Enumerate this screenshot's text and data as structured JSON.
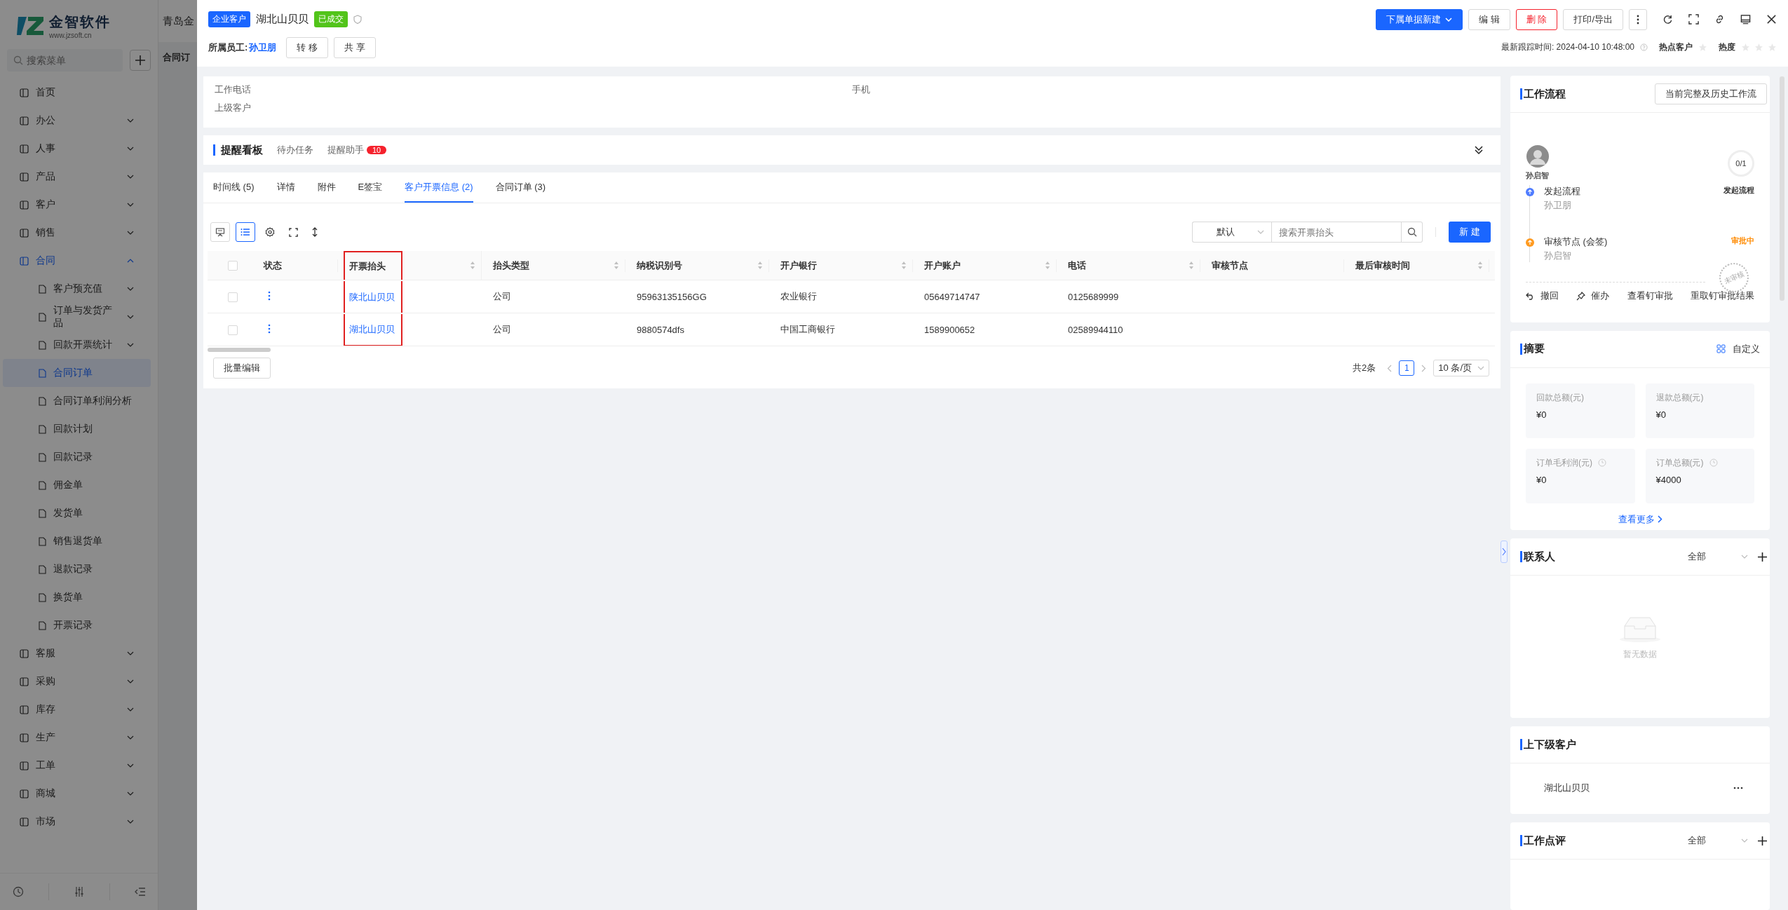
{
  "background_app": {
    "header_title": "青岛金",
    "tab": "合同订"
  },
  "sidebar": {
    "logo": {
      "name": "金智软件",
      "url": "www.jzsoft.cn"
    },
    "search": {
      "placeholder": "搜索菜单"
    },
    "items": [
      {
        "label": "首页",
        "selected": false
      },
      {
        "label": "办公",
        "selected": false,
        "expanded": false
      },
      {
        "label": "人事",
        "selected": false,
        "expanded": false
      },
      {
        "label": "产品",
        "selected": false,
        "expanded": false
      },
      {
        "label": "客户",
        "selected": false,
        "expanded": false
      },
      {
        "label": "销售",
        "selected": false,
        "expanded": false
      },
      {
        "label": "合同",
        "selected": true,
        "expanded": true,
        "children": [
          {
            "label": "客户预充值",
            "selected": false,
            "expanded": false
          },
          {
            "label": "订单与发货产品",
            "selected": false,
            "expanded": false
          },
          {
            "label": "回款开票统计",
            "selected": false,
            "expanded": false
          },
          {
            "label": "合同订单",
            "selected": true
          },
          {
            "label": "合同订单利润分析",
            "selected": false
          },
          {
            "label": "回款计划",
            "selected": false
          },
          {
            "label": "回款记录",
            "selected": false
          },
          {
            "label": "佣金单",
            "selected": false
          },
          {
            "label": "发货单",
            "selected": false
          },
          {
            "label": "销售退货单",
            "selected": false
          },
          {
            "label": "退款记录",
            "selected": false
          },
          {
            "label": "换货单",
            "selected": false
          },
          {
            "label": "开票记录",
            "selected": false
          }
        ]
      },
      {
        "label": "客服",
        "selected": false,
        "expanded": false
      },
      {
        "label": "采购",
        "selected": false,
        "expanded": false
      },
      {
        "label": "库存",
        "selected": false,
        "expanded": false
      },
      {
        "label": "生产",
        "selected": false,
        "expanded": false
      },
      {
        "label": "工单",
        "selected": false,
        "expanded": false
      },
      {
        "label": "商城",
        "selected": false,
        "expanded": false
      },
      {
        "label": "市场",
        "selected": false,
        "expanded": false
      }
    ]
  },
  "header": {
    "type_badge": "企业客户",
    "title": "湖北山贝贝",
    "status_badge": "已成交",
    "owner_label": "所属员工:",
    "owner": "孙卫朋",
    "owner_buttons": [
      "转 移",
      "共 享"
    ],
    "actions": [
      {
        "label": "下属单据新建",
        "kind": "primary"
      },
      {
        "label": "编 辑",
        "kind": "default"
      },
      {
        "label": "删 除",
        "kind": "danger"
      },
      {
        "label": "打印/导出",
        "kind": "default"
      }
    ],
    "last_track": "最新跟踪时间: 2024-04-10 10:48:00",
    "hot_customer": {
      "label": "热点客户",
      "on": false
    },
    "heat": {
      "label": "热度",
      "stars": 0
    }
  },
  "info": {
    "fields": [
      "工作电话",
      "手机",
      "上级客户"
    ]
  },
  "reminder": {
    "title": "提醒看板",
    "tabs": [
      {
        "label": "待办任务",
        "selected": false
      },
      {
        "label": "提醒助手",
        "badge": "10",
        "selected": false
      }
    ]
  },
  "tabs": [
    {
      "label": "时间线 (5)",
      "selected": false
    },
    {
      "label": "详情",
      "selected": false
    },
    {
      "label": "附件",
      "selected": false
    },
    {
      "label": "E签宝",
      "selected": false
    },
    {
      "label": "客户开票信息 (2)",
      "selected": true
    },
    {
      "label": "合同订单 (3)",
      "selected": false
    }
  ],
  "toolbar": {
    "views": [
      {
        "kind": "card",
        "selected": false
      },
      {
        "kind": "list",
        "selected": true
      }
    ],
    "filter": "默认",
    "search": {
      "placeholder": "搜索开票抬头"
    },
    "new_button": "新 建"
  },
  "table": {
    "all_checked": false,
    "columns": [
      {
        "label": "状态",
        "sortable": false,
        "highlighted": false
      },
      {
        "label": "开票抬头",
        "sortable": true,
        "highlighted": true
      },
      {
        "label": "抬头类型",
        "sortable": true,
        "highlighted": false
      },
      {
        "label": "纳税识别号",
        "sortable": true,
        "highlighted": false
      },
      {
        "label": "开户银行",
        "sortable": true,
        "highlighted": false
      },
      {
        "label": "开户账户",
        "sortable": true,
        "highlighted": false
      },
      {
        "label": "电话",
        "sortable": true,
        "highlighted": false
      },
      {
        "label": "审核节点",
        "sortable": false,
        "highlighted": false
      },
      {
        "label": "最后审核时间",
        "sortable": true,
        "highlighted": false
      }
    ],
    "rows": [
      {
        "checked": false,
        "cells": [
          "",
          "陕北山贝贝",
          "公司",
          "95963135156GG",
          "农业银行",
          "05649714747",
          "0125689999"
        ]
      },
      {
        "checked": false,
        "cells": [
          "",
          "湖北山贝贝",
          "公司",
          "9880574dfs",
          "中国工商银行",
          "1589900652",
          "02589944110"
        ]
      }
    ]
  },
  "bulk_edit": "批量编辑",
  "pagination": {
    "total": "共2条",
    "pages": [
      {
        "label": "1",
        "selected": true
      }
    ],
    "page_size": "10 条/页"
  },
  "workflow": {
    "title": "工作流程",
    "history_button": "当前完整及历史工作流",
    "assignee": "孙启智",
    "progress": "0/1",
    "steps": [
      {
        "kind": "start",
        "title": "发起流程",
        "person": "孙卫朋",
        "status": "发起流程"
      },
      {
        "kind": "review",
        "title": "审核节点 (会签)",
        "person": "孙启智",
        "status": "审批中"
      }
    ],
    "stamp": "未审核",
    "actions": [
      {
        "kind": "undo",
        "label": "撤回"
      },
      {
        "kind": "pin",
        "label": "催办"
      },
      {
        "kind": "text",
        "label": "查看钉审批"
      },
      {
        "kind": "text",
        "label": "重取钉审批结果"
      }
    ]
  },
  "summary": {
    "title": "摘要",
    "customize": "自定义",
    "stats": [
      {
        "label": "回款总额(元)",
        "value": "¥0",
        "info": false
      },
      {
        "label": "退款总额(元)",
        "value": "¥0",
        "info": false
      },
      {
        "label": "订单毛利润(元)",
        "value": "¥0",
        "info": true
      },
      {
        "label": "订单总额(元)",
        "value": "¥4000",
        "info": true
      }
    ],
    "more": "查看更多"
  },
  "contacts": {
    "title": "联系人",
    "filter": "全部",
    "empty_text": "暂无数据"
  },
  "relations": {
    "title": "上下级客户",
    "items": [
      "湖北山贝贝"
    ]
  },
  "reviews": {
    "title": "工作点评",
    "filter": "全部"
  }
}
